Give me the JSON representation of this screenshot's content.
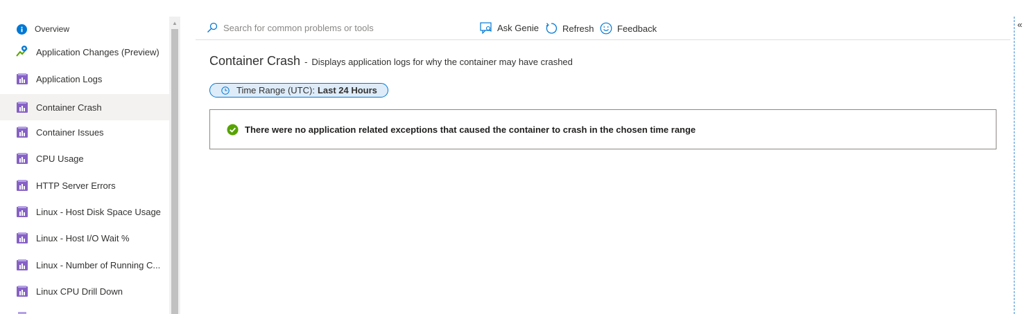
{
  "sidebar": {
    "items": [
      {
        "label": "Overview",
        "icon": "info-icon"
      },
      {
        "label": "Application Changes (Preview)",
        "icon": "app-changes-icon"
      },
      {
        "label": "Application Logs",
        "icon": "detector-icon"
      },
      {
        "label": "Container Crash",
        "icon": "detector-icon",
        "selected": true
      },
      {
        "label": "Container Issues",
        "icon": "detector-icon"
      },
      {
        "label": "CPU Usage",
        "icon": "detector-icon"
      },
      {
        "label": "HTTP Server Errors",
        "icon": "detector-icon"
      },
      {
        "label": "Linux - Host Disk Space Usage",
        "icon": "detector-icon"
      },
      {
        "label": "Linux - Host I/O Wait %",
        "icon": "detector-icon"
      },
      {
        "label": "Linux - Number of Running C...",
        "icon": "detector-icon"
      },
      {
        "label": "Linux CPU Drill Down",
        "icon": "detector-icon"
      }
    ]
  },
  "toolbar": {
    "search_placeholder": "Search for common problems or tools",
    "ask_genie": "Ask Genie",
    "refresh": "Refresh",
    "feedback": "Feedback"
  },
  "main": {
    "title": "Container Crash",
    "separator": "-",
    "description": "Displays application logs for why the container may have crashed",
    "time_range_label": "Time Range (UTC):",
    "time_range_value": "Last 24 Hours",
    "result_message": "There were no application related exceptions that caused the container to crash in the chosen time range"
  },
  "colors": {
    "accent": "#0078d4",
    "success": "#57a300",
    "detector_icon": "#8661c5"
  },
  "collapse_glyph": "«"
}
